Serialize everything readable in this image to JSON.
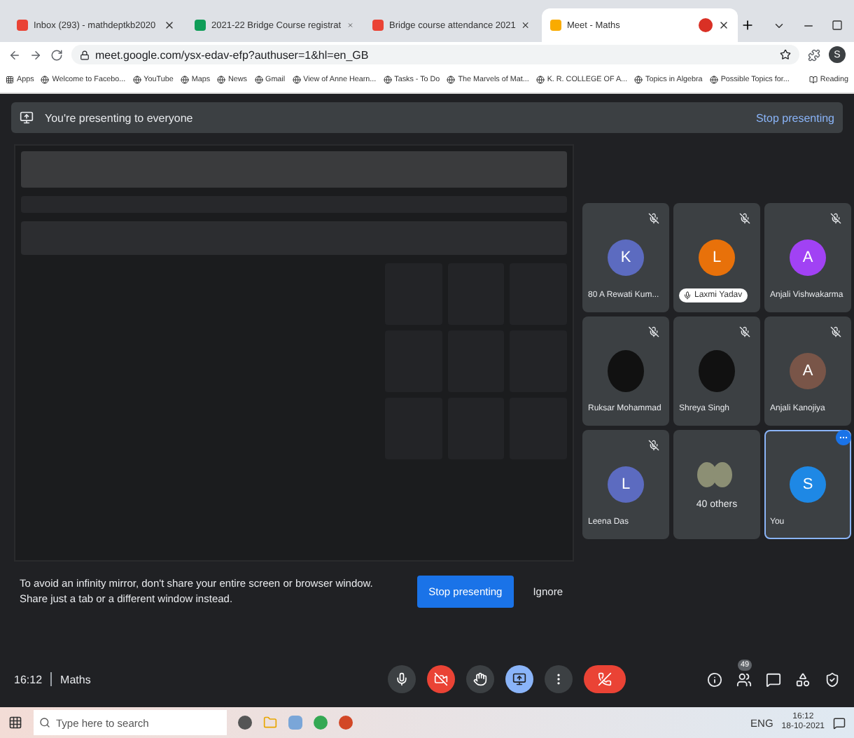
{
  "browser": {
    "tabs": [
      {
        "title": "Inbox (293) - mathdeptkb2020",
        "kind": "mail",
        "selected": false,
        "recording": false
      },
      {
        "title": "2021-22 Bridge Course registrat",
        "kind": "sheet",
        "selected": false,
        "recording": false
      },
      {
        "title": "Bridge course attendance 2021",
        "kind": "mail",
        "selected": false,
        "recording": false
      },
      {
        "title": "Meet - Maths",
        "kind": "meet",
        "selected": true,
        "recording": true
      }
    ],
    "url": "meet.google.com/ysx-edav-efp?authuser=1&hl=en_GB",
    "profile_initial": "S",
    "bookmarks": [
      "Apps",
      "Welcome to Facebo...",
      "YouTube",
      "Maps",
      "News",
      "Gmail",
      "View of Anne Hearn...",
      "Tasks - To Do",
      "The Marvels of Mat...",
      "K. R. COLLEGE OF A...",
      "Topics in Algebra",
      "Possible Topics for..."
    ],
    "reading_list": "Reading"
  },
  "banner": {
    "text": "You're presenting to everyone",
    "action": "Stop presenting"
  },
  "tiles": [
    {
      "name": "80 A Rewati Kum...",
      "kind": "avatar",
      "initial": "K",
      "color": "#5c6bc0",
      "muted": true,
      "speaking": false,
      "selected": false
    },
    {
      "name": "Laxmi Yadav",
      "kind": "avatar",
      "initial": "L",
      "color": "#e8710a",
      "muted": true,
      "speaking": true,
      "selected": false
    },
    {
      "name": "Anjali Vishwakarma",
      "kind": "avatar",
      "initial": "A",
      "color": "#a142f4",
      "muted": true,
      "speaking": false,
      "selected": false
    },
    {
      "name": "Ruksar Mohammad",
      "kind": "photo",
      "muted": true,
      "speaking": false,
      "selected": false
    },
    {
      "name": "Shreya Singh",
      "kind": "photo",
      "muted": true,
      "speaking": false,
      "selected": false
    },
    {
      "name": "Anjali Kanojiya",
      "kind": "avatar",
      "initial": "A",
      "color": "#795548",
      "muted": true,
      "speaking": false,
      "selected": false
    },
    {
      "name": "Leena Das",
      "kind": "avatar",
      "initial": "L",
      "color": "#5c6bc0",
      "muted": true,
      "speaking": false,
      "selected": false
    },
    {
      "name": "40 others",
      "kind": "others",
      "muted": false,
      "speaking": false,
      "selected": false
    },
    {
      "name": "You",
      "kind": "avatar",
      "initial": "S",
      "color": "#1e88e5",
      "muted": false,
      "speaking": false,
      "selected": true
    }
  ],
  "notice": {
    "text": "To avoid an infinity mirror, don't share your entire screen or browser window. Share just a tab or a different window instead.",
    "primary": "Stop presenting",
    "secondary": "Ignore"
  },
  "meeting": {
    "time": "16:12",
    "name": "Maths",
    "people_count": "49"
  },
  "controls": [
    {
      "kind": "mic",
      "on": true
    },
    {
      "kind": "camera",
      "on": false
    },
    {
      "kind": "hand",
      "on": false
    },
    {
      "kind": "present",
      "on": true
    },
    {
      "kind": "more",
      "on": false
    },
    {
      "kind": "end",
      "on": false
    }
  ],
  "taskbar": {
    "search_placeholder": "Type here to search",
    "language": "ENG",
    "time": "16:12",
    "date": "18-10-2021"
  }
}
